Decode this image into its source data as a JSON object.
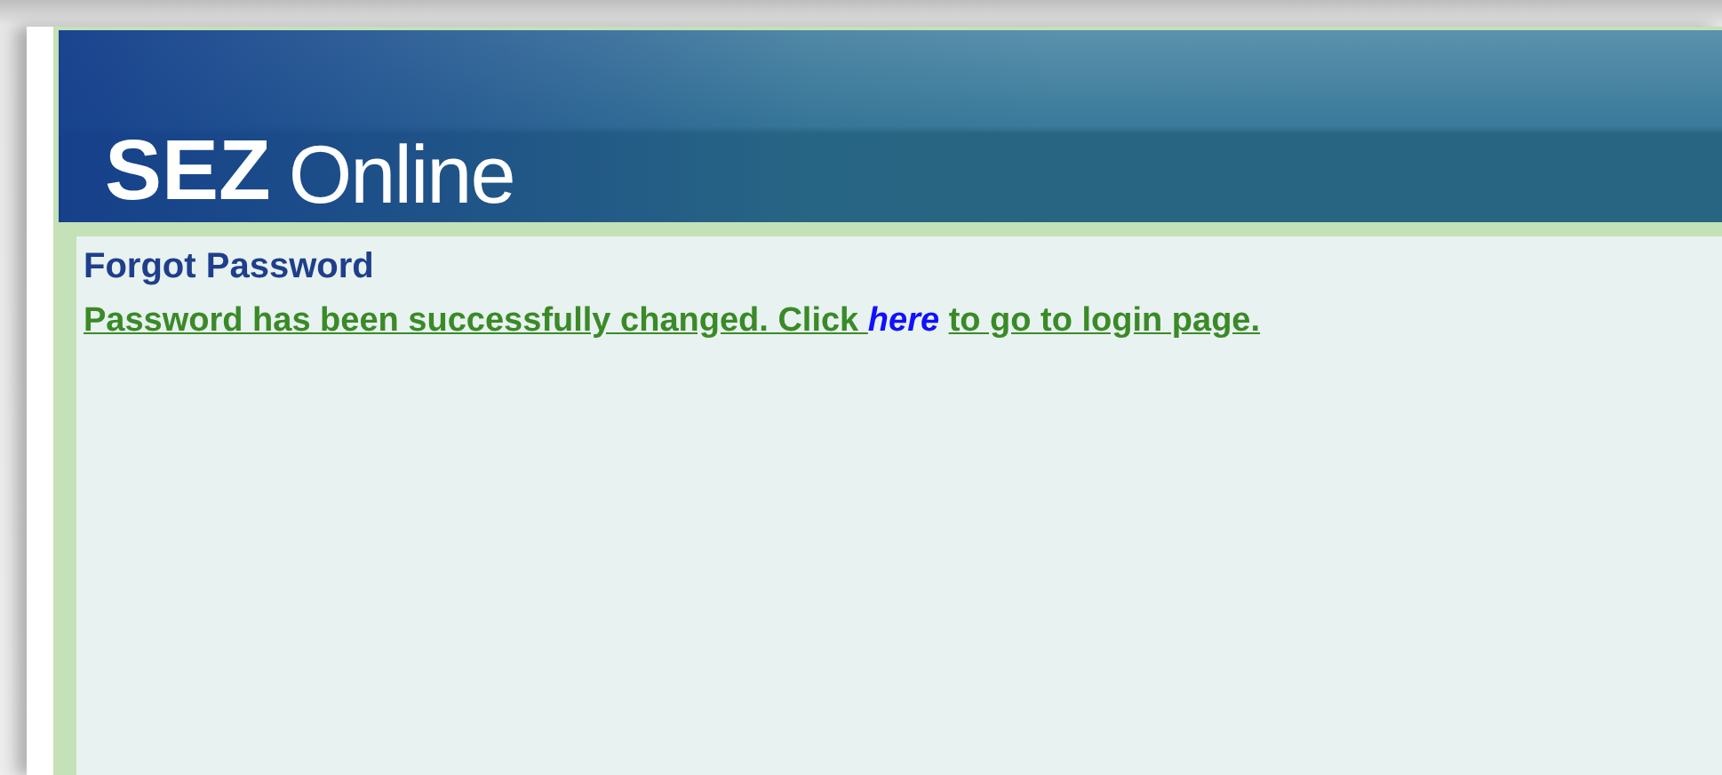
{
  "header": {
    "brand_bold": "SEZ",
    "brand_light": "Online"
  },
  "page_title": "Forgot Password",
  "message": {
    "before": "Password has been successfully changed. Click ",
    "link": "here",
    "after": "to go to login page."
  }
}
